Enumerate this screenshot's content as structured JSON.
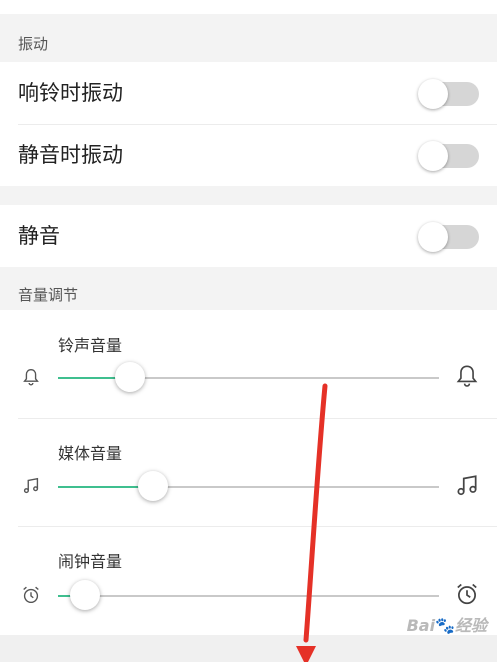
{
  "sections": {
    "vibration": {
      "header": "振动",
      "ring_vibrate": {
        "label": "响铃时振动",
        "enabled": false
      },
      "silent_vibrate": {
        "label": "静音时振动",
        "enabled": false
      }
    },
    "mute": {
      "label": "静音",
      "enabled": false
    },
    "volume": {
      "header": "音量调节",
      "sliders": [
        {
          "label": "铃声音量",
          "value": 0.19,
          "icon_left": "bell-small-icon",
          "icon_right": "bell-icon"
        },
        {
          "label": "媒体音量",
          "value": 0.25,
          "icon_left": "music-note-small-icon",
          "icon_right": "music-note-icon"
        },
        {
          "label": "闹钟音量",
          "value": 0.07,
          "icon_left": "alarm-clock-small-icon",
          "icon_right": "alarm-clock-icon"
        }
      ]
    }
  },
  "annotation": {
    "arrow_color": "#e53127"
  },
  "watermark": {
    "text": "Bai",
    "paw": "🐾",
    "suffix": "经验"
  },
  "colors": {
    "accent": "#3fbf8f",
    "toggle_off": "#d6d6d6"
  }
}
